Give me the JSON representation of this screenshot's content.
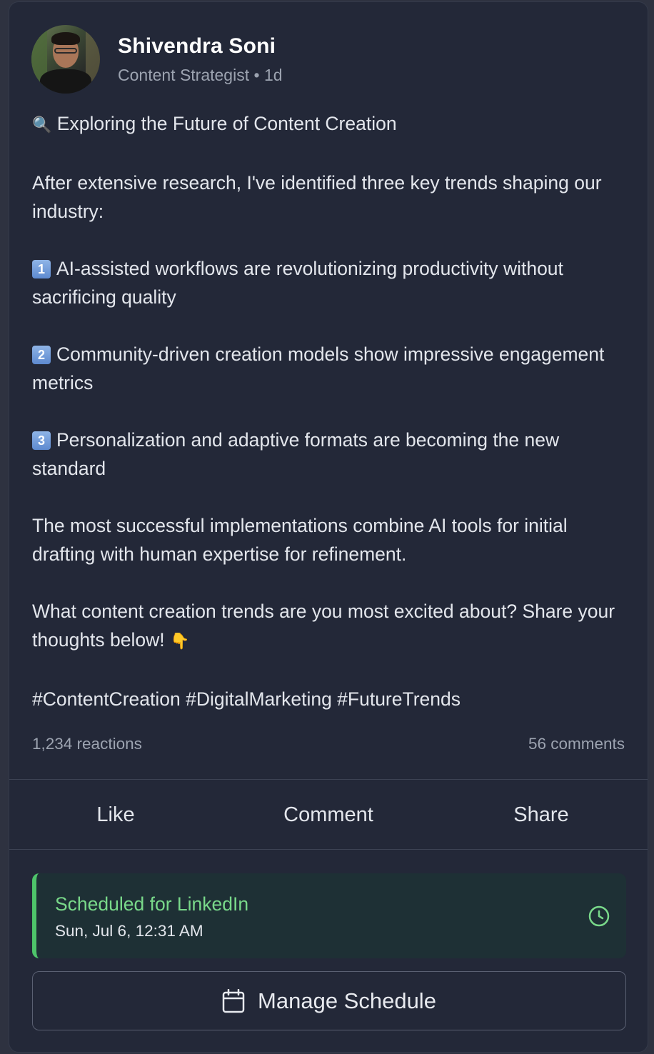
{
  "author": {
    "name": "Shivendra Soni",
    "role": "Content Strategist",
    "separator": "•",
    "time": "1d"
  },
  "post": {
    "title_emoji": "🔍",
    "title": "Exploring the Future of Content Creation",
    "intro": "After extensive research, I've identified three key trends shaping our industry:",
    "points": [
      {
        "badge": "1",
        "text": "AI-assisted workflows are revolutionizing productivity without sacrificing quality"
      },
      {
        "badge": "2",
        "text": "Community-driven creation models show impressive engagement metrics"
      },
      {
        "badge": "3",
        "text": "Personalization and adaptive formats are becoming the new standard"
      }
    ],
    "conclusion": "The most successful implementations combine AI tools for initial drafting with human expertise for refinement.",
    "question": "What content creation trends are you most excited about? Share your thoughts below!",
    "question_emoji": "👇",
    "hashtags": "#ContentCreation #DigitalMarketing #FutureTrends"
  },
  "stats": {
    "reactions": "1,234 reactions",
    "comments": "56 comments"
  },
  "actions": {
    "like": "Like",
    "comment": "Comment",
    "share": "Share"
  },
  "schedule": {
    "title": "Scheduled for LinkedIn",
    "time": "Sun, Jul 6, 12:31 AM",
    "icon": "clock-icon",
    "accent": "#4ec46a"
  },
  "manage_button": {
    "label": "Manage Schedule",
    "icon": "calendar-icon"
  }
}
